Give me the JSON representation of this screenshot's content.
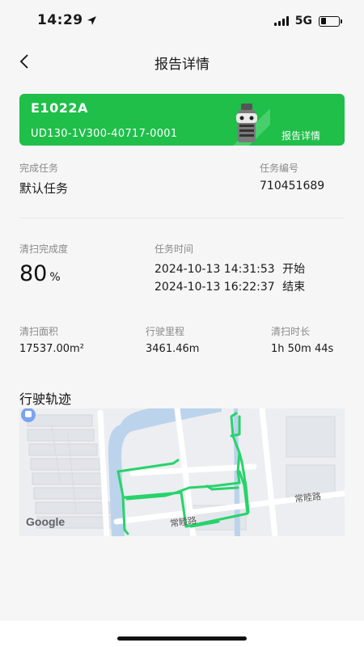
{
  "status": {
    "time": "14:29",
    "network": "5G"
  },
  "nav": {
    "title": "报告详情"
  },
  "device": {
    "sn": "E1022A",
    "model": "UD130-1V300-40717-0001",
    "report_link": "报告详情"
  },
  "task": {
    "name_label": "完成任务",
    "name": "默认任务",
    "id_label": "任务编号",
    "id": "710451689"
  },
  "progress": {
    "label": "清扫完成度",
    "value": "80",
    "unit": "%"
  },
  "time": {
    "label": "任务时间",
    "start": "2024-10-13 14:31:53",
    "start_tag": "开始",
    "end": "2024-10-13 16:22:37",
    "end_tag": "结束"
  },
  "stats": {
    "area_label": "清扫面积",
    "area": "17537.00m²",
    "distance_label": "行驶里程",
    "distance": "3461.46m",
    "duration_label": "清扫时长",
    "duration": "1h 50m 44s"
  },
  "map": {
    "title": "行驶轨迹",
    "road_name_1": "常睦路",
    "road_name_2": "常睦路",
    "attribution": "Google"
  },
  "colors": {
    "accent": "#1fbf4a",
    "trajectory": "#27d36b"
  }
}
